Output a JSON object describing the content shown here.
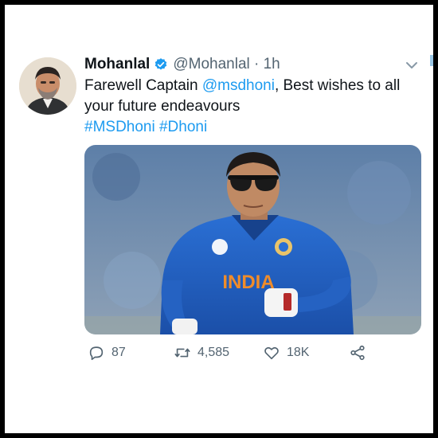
{
  "tweet": {
    "display_name": "Mohanlal",
    "handle_time": "@Mohanlal · 1h",
    "text_before": "Farewell Captain ",
    "mention": "@msdhoni",
    "text_after": ", Best wishes to all your future endeavours",
    "hashtags": "#MSDhoni #Dhoni",
    "jersey_text": "INDIA"
  },
  "actions": {
    "reply_count": "87",
    "retweet_count": "4,585",
    "like_count": "18K"
  },
  "colors": {
    "link": "#1d9bf0",
    "jersey": "#1f5fc4",
    "muted": "#536471"
  }
}
